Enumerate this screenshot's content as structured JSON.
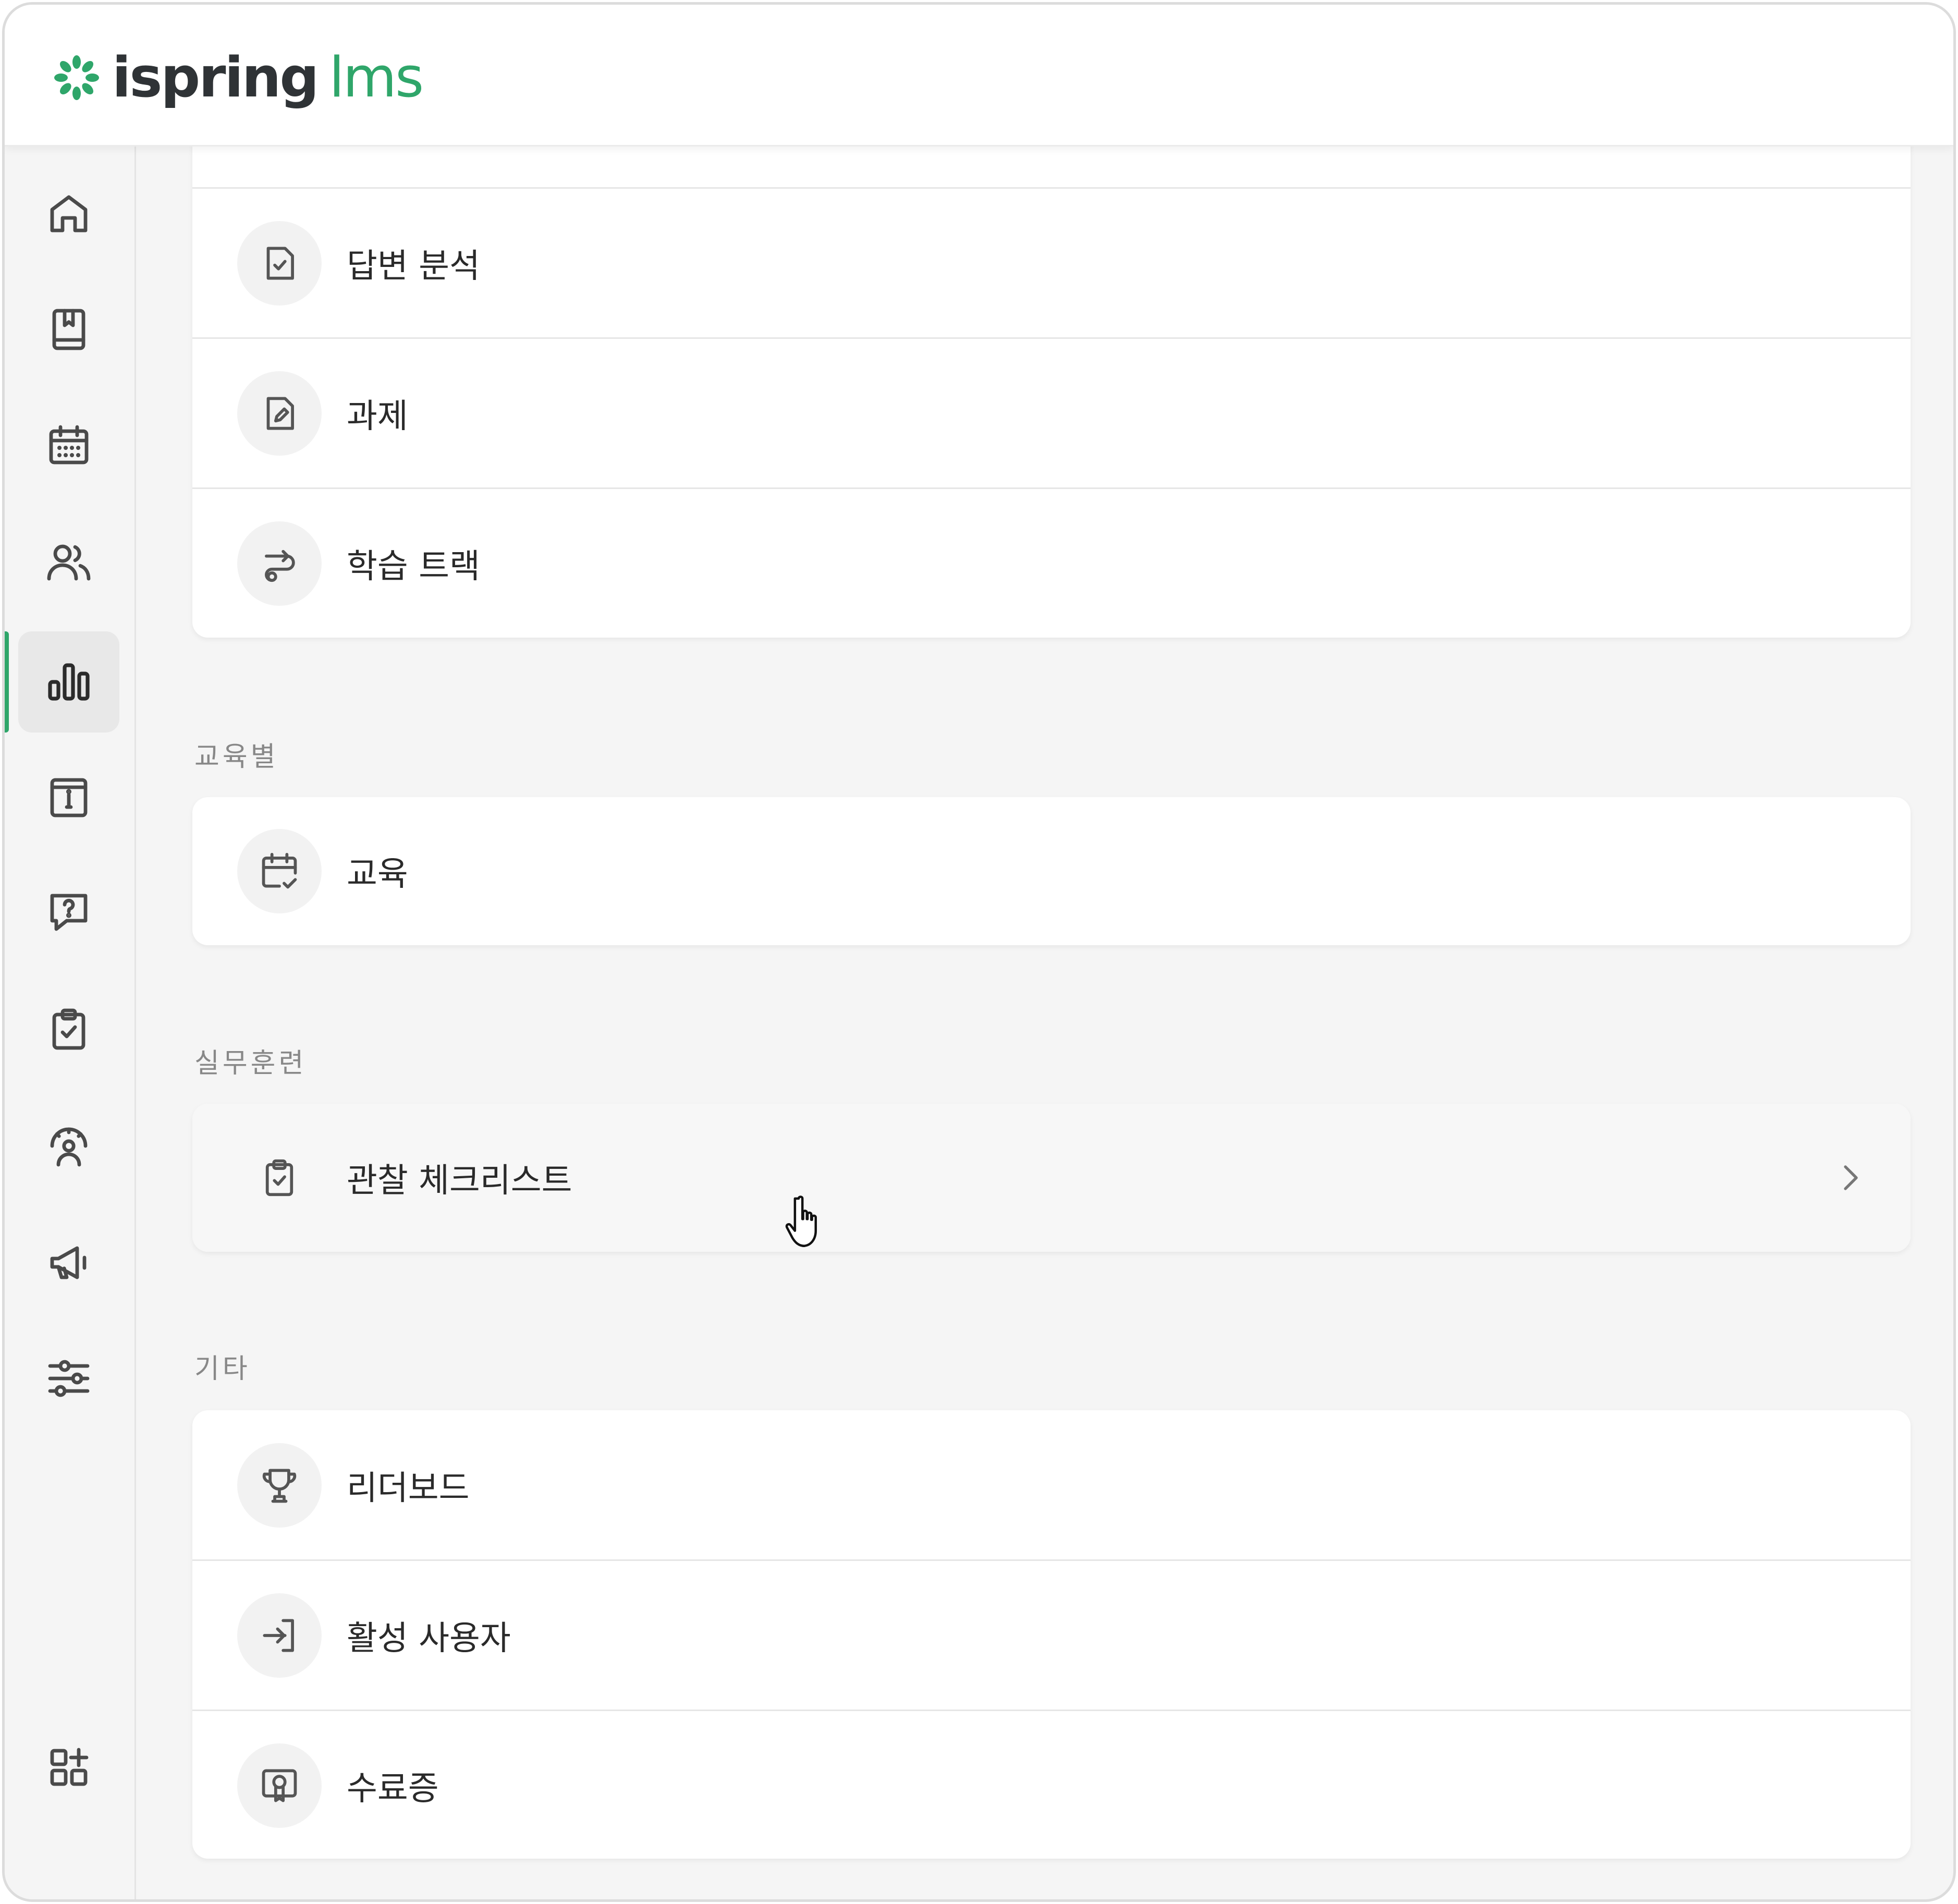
{
  "brand": {
    "name_part1": "ispring",
    "name_part2": "lms",
    "color": "#2fa66a"
  },
  "sidebar": {
    "items": [
      {
        "icon": "home-icon",
        "active": false
      },
      {
        "icon": "book-icon",
        "active": false
      },
      {
        "icon": "calendar-icon",
        "active": false
      },
      {
        "icon": "users-icon",
        "active": false
      },
      {
        "icon": "bar-chart-icon",
        "active": true
      },
      {
        "icon": "info-icon",
        "active": false
      },
      {
        "icon": "question-chat-icon",
        "active": false
      },
      {
        "icon": "clipboard-check-icon",
        "active": false
      },
      {
        "icon": "user-gauge-icon",
        "active": false
      },
      {
        "icon": "megaphone-icon",
        "active": false
      },
      {
        "icon": "sliders-icon",
        "active": false
      },
      {
        "icon": "add-app-icon",
        "active": false
      }
    ]
  },
  "reports": {
    "top_group": [
      {
        "label": "답변 분석",
        "icon": "file-check-icon"
      },
      {
        "label": "과제",
        "icon": "file-edit-icon"
      },
      {
        "label": "학습 트랙",
        "icon": "route-icon"
      }
    ],
    "by_training": {
      "title": "교육별",
      "items": [
        {
          "label": "교육",
          "icon": "calendar-check-icon"
        }
      ]
    },
    "practical": {
      "title": "실무훈련",
      "items": [
        {
          "label": "관찰 체크리스트",
          "icon": "clipboard-check-icon",
          "hovered": true
        }
      ]
    },
    "other": {
      "title": "기타",
      "items": [
        {
          "label": "리더보드",
          "icon": "trophy-icon"
        },
        {
          "label": "활성 사용자",
          "icon": "sign-in-icon"
        },
        {
          "label": "수료증",
          "icon": "certificate-icon"
        }
      ]
    }
  }
}
